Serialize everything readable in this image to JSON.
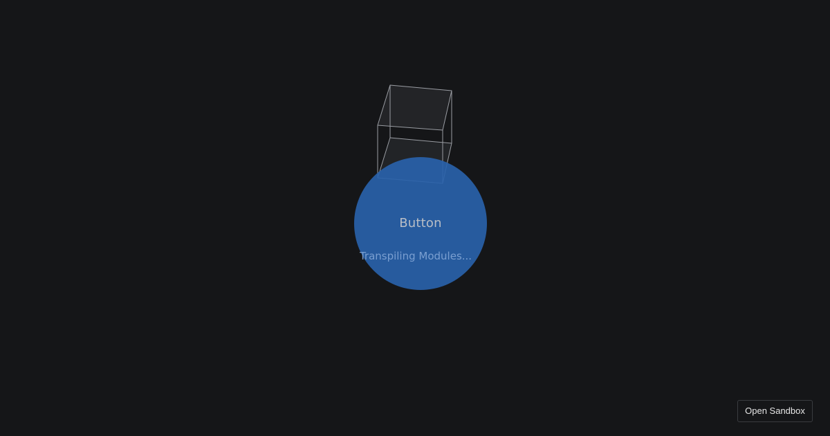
{
  "main": {
    "button_label": "Button",
    "loading_text": "Transpiling Modules..."
  },
  "footer": {
    "open_sandbox_label": "Open Sandbox"
  },
  "colors": {
    "background": "#151618",
    "button_fill": "#2962aa",
    "cube_stroke": "#9a9da3"
  },
  "icons": {
    "loader": "wireframe-cube-icon"
  }
}
